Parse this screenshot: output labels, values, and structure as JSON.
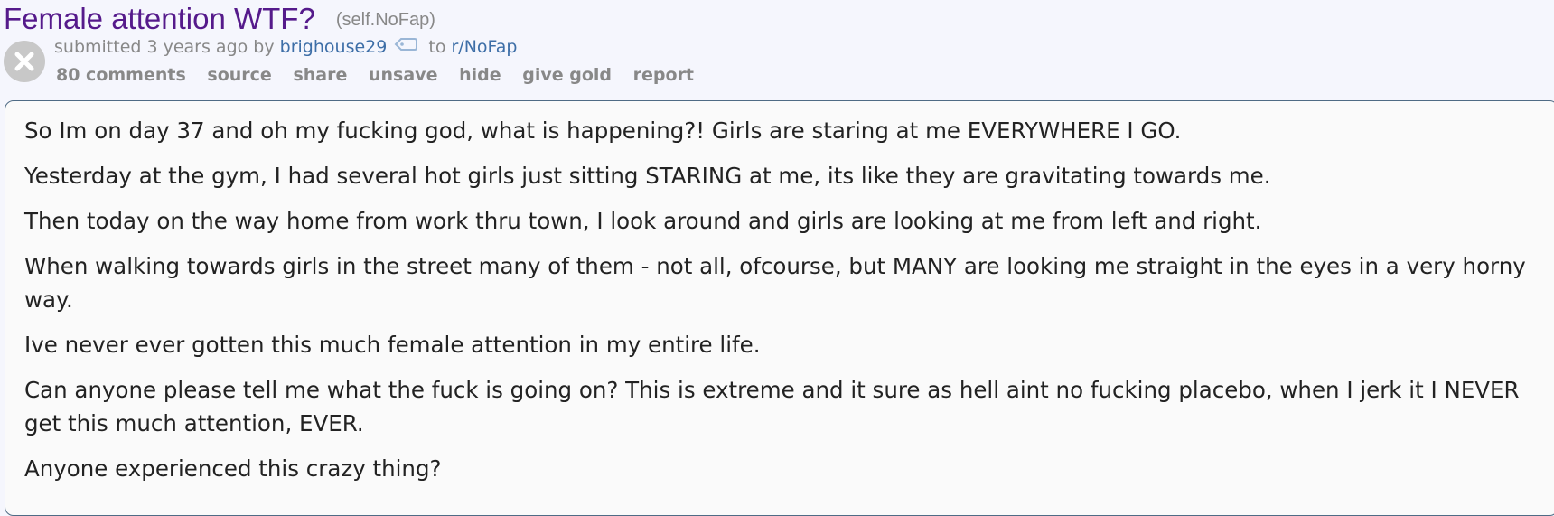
{
  "post": {
    "title": "Female attention WTF?",
    "domain": "(self.NoFap)",
    "tagline": {
      "prefix": "submitted 3 years ago by ",
      "author": "brighouse29",
      "to": " to ",
      "subreddit": "r/NoFap"
    },
    "buttons": {
      "comments": "80 comments",
      "source": "source",
      "share": "share",
      "unsave": "unsave",
      "hide": "hide",
      "give_gold": "give gold",
      "report": "report"
    },
    "body": [
      "So Im on day 37 and oh my fucking god, what is happening?! Girls are staring at me EVERYWHERE I GO.",
      "Yesterday at the gym, I had several hot girls just sitting STARING at me, its like they are gravitating towards me.",
      "Then today on the way home from work thru town, I look around and girls are looking at me from left and right.",
      "When walking towards girls in the street many of them - not all, ofcourse, but MANY are looking me straight in the eyes in a very horny way.",
      "Ive never ever gotten this much female attention in my entire life.",
      "Can anyone please tell me what the fuck is going on? This is extreme and it sure as hell aint no fucking placebo, when I jerk it I NEVER get this much attention, EVER.",
      "Anyone experienced this crazy thing?"
    ]
  },
  "icons": {
    "close": "close-icon",
    "tag": "tag-icon"
  },
  "colors": {
    "title": "#551a8b",
    "link": "#3d6ea7",
    "muted": "#888888",
    "body_border": "#4f6b85"
  }
}
